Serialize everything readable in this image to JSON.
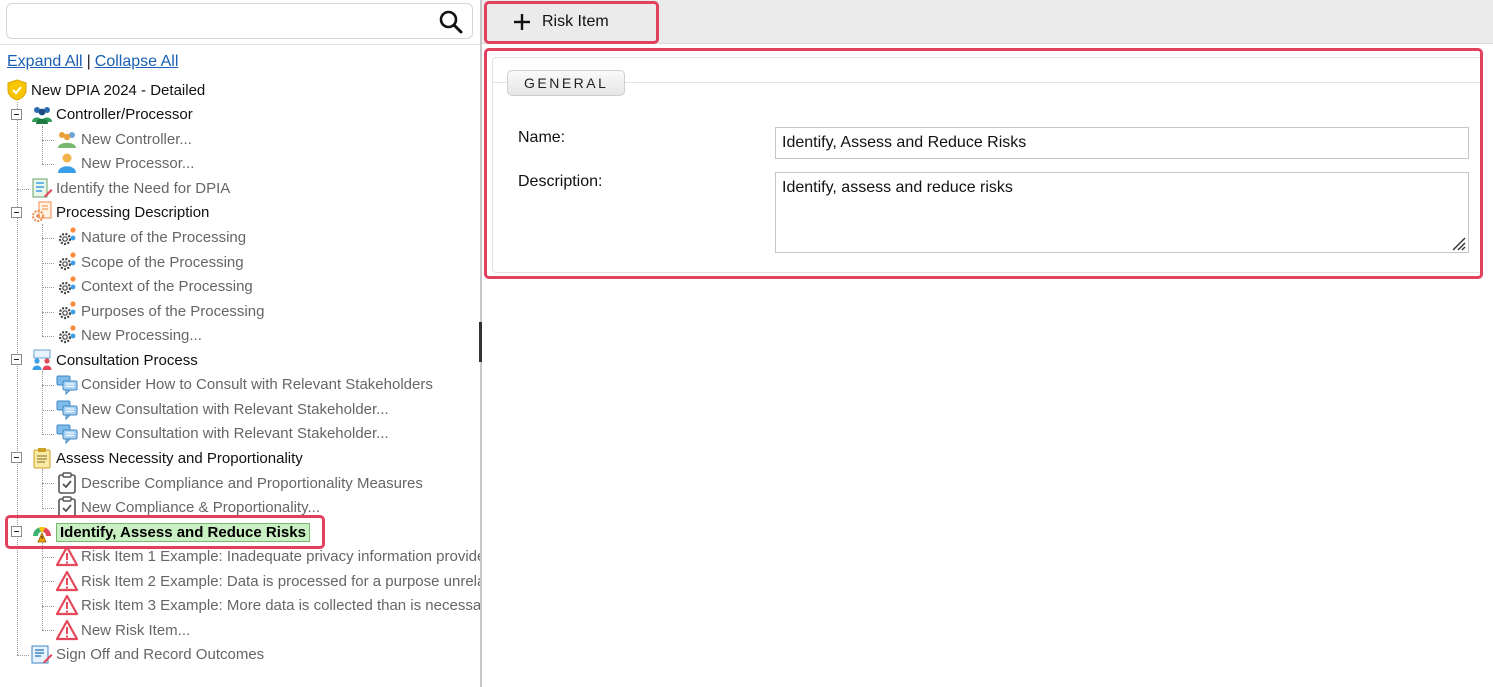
{
  "search": {
    "value": "",
    "placeholder": ""
  },
  "tree_controls": {
    "expand_all": "Expand All",
    "separator": "|",
    "collapse_all": "Collapse All"
  },
  "tree": {
    "root": "New DPIA 2024 - Detailed",
    "controller_processor": "Controller/Processor",
    "new_controller": "New Controller...",
    "new_processor": "New Processor...",
    "identify_need": "Identify the Need for DPIA",
    "processing_description": "Processing Description",
    "nature": "Nature of the Processing",
    "scope": "Scope of the Processing",
    "context": "Context of the Processing",
    "purposes": "Purposes of the Processing",
    "new_processing": "New Processing...",
    "consultation_process": "Consultation Process",
    "consider_consult": "Consider How to Consult with Relevant Stakeholders",
    "new_consultation_1": "New Consultation with Relevant Stakeholder...",
    "new_consultation_2": "New Consultation with Relevant Stakeholder...",
    "assess_necessity": "Assess Necessity and Proportionality",
    "describe_compliance": "Describe Compliance and Proportionality Measures",
    "new_compliance": "New Compliance & Proportionality...",
    "identify_risks": "Identify, Assess and Reduce Risks",
    "risk_item_1": "Risk Item 1 Example: Inadequate privacy information provide",
    "risk_item_2": "Risk Item 2 Example: Data is processed for a purpose unrela",
    "risk_item_3": "Risk Item 3 Example: More data is collected than is necessar",
    "new_risk_item": "New Risk Item...",
    "sign_off": "Sign Off and Record Outcomes"
  },
  "toolbar": {
    "risk_item_label": "Risk Item"
  },
  "form": {
    "section_tab": "GENERAL",
    "name_label": "Name:",
    "name_value": "Identify, Assess and Reduce Risks",
    "description_label": "Description:",
    "description_value": "Identify, assess and reduce risks"
  },
  "colors": {
    "highlight": "#e0415e",
    "selected_bg": "#c9f0c2",
    "link": "#1a5fb4",
    "toolbar_bg": "#ebebeb"
  },
  "icons": {
    "search": "search-icon",
    "plus": "plus-icon",
    "shield": "shield-icon",
    "people": "people-icon",
    "person": "person-icon",
    "document": "document-icon",
    "gear": "gear-icon",
    "chat": "chat-icon",
    "clipboard": "clipboard-icon",
    "warning": "warning-icon",
    "gauge": "gauge-icon",
    "signoff": "signoff-icon"
  }
}
